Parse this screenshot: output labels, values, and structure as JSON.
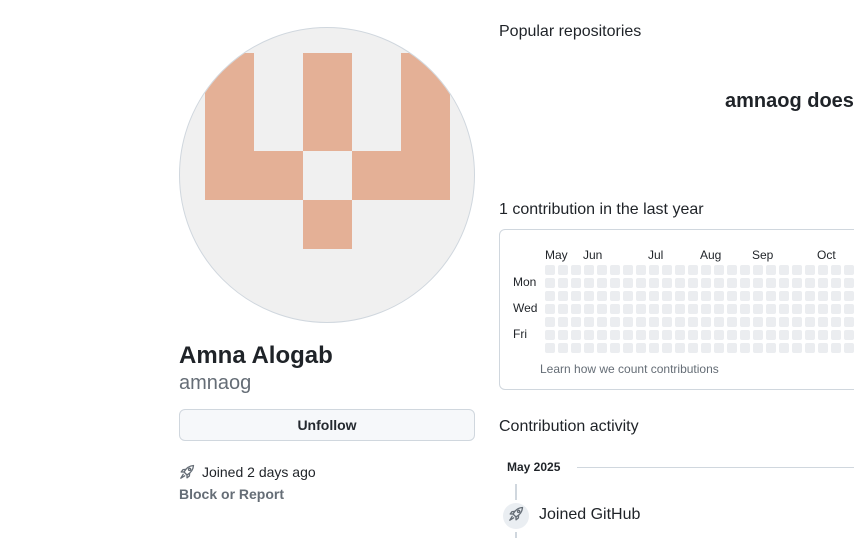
{
  "profile": {
    "full_name": "Amna Alogab",
    "login": "amnaog",
    "unfollow_label": "Unfollow",
    "joined_text": "Joined 2 days ago",
    "block_report_label": "Block or Report",
    "avatar_color": "#e4b096",
    "avatar_bg": "#f0f0f0"
  },
  "popular": {
    "title": "Popular repositories",
    "blank_message": "amnaog doesn"
  },
  "contributions": {
    "title": "1 contribution in the last year",
    "months": [
      "May",
      "Jun",
      "Jul",
      "Aug",
      "Sep",
      "Oct"
    ],
    "day_labels": [
      "Mon",
      "Wed",
      "Fri"
    ],
    "learn_link": "Learn how we count contributions",
    "cell_color": "#ebedf0"
  },
  "activity": {
    "title": "Contribution activity",
    "month": "May 2025",
    "events": [
      {
        "icon": "rocket-icon",
        "text": "Joined GitHub"
      }
    ]
  }
}
